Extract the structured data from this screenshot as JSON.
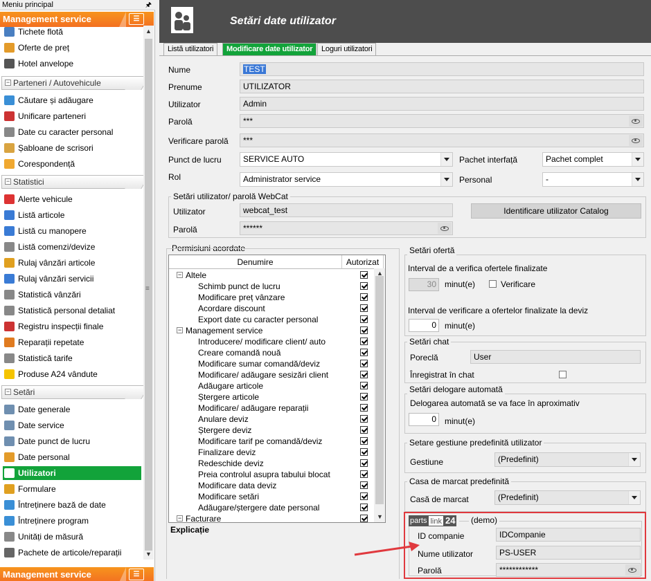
{
  "sidebar": {
    "menu_title": "Meniu principal",
    "top_bar": "Management service",
    "bottom_bar": "Management service",
    "items_a": [
      {
        "label": "Tichete flotă",
        "icon": "ticket-icon"
      },
      {
        "label": "Oferte de preț",
        "icon": "offer-icon"
      },
      {
        "label": "Hotel anvelope",
        "icon": "tire-icon"
      }
    ],
    "group_partners": "Parteneri / Autovehicule",
    "items_b": [
      {
        "label": "Căutare și adăugare",
        "icon": "search-add-icon"
      },
      {
        "label": "Unificare parteneri",
        "icon": "merge-partners-icon"
      },
      {
        "label": "Date cu caracter personal",
        "icon": "personal-data-icon"
      },
      {
        "label": "Șabloane de scrisori",
        "icon": "letter-template-icon"
      },
      {
        "label": "Corespondență",
        "icon": "mail-icon"
      }
    ],
    "group_stats": "Statistici",
    "items_c": [
      {
        "label": "Alerte vehicule",
        "icon": "alert-icon"
      },
      {
        "label": "Listă articole",
        "icon": "list-icon"
      },
      {
        "label": "Listă cu manopere",
        "icon": "wrench-icon"
      },
      {
        "label": "Listă comenzi/devize",
        "icon": "orders-icon"
      },
      {
        "label": "Rulaj vânzări articole",
        "icon": "sales-icon"
      },
      {
        "label": "Rulaj vânzări servicii",
        "icon": "services-icon"
      },
      {
        "label": "Statistică vânzări",
        "icon": "chart-icon"
      },
      {
        "label": "Statistică personal detaliat",
        "icon": "staff-chart-icon"
      },
      {
        "label": "Registru inspecții finale",
        "icon": "inspection-icon"
      },
      {
        "label": "Reparații repetate",
        "icon": "repeat-icon"
      },
      {
        "label": "Statistică tarife",
        "icon": "tariff-icon"
      },
      {
        "label": "Produse A24 vândute",
        "icon": "a24-icon"
      }
    ],
    "group_settings": "Setări",
    "items_d": [
      {
        "label": "Date generale",
        "icon": "doc-icon"
      },
      {
        "label": "Date service",
        "icon": "doc-icon"
      },
      {
        "label": "Date punct de lucru",
        "icon": "workplace-icon"
      },
      {
        "label": "Date personal",
        "icon": "person-icon"
      },
      {
        "label": "Utilizatori",
        "icon": "users-icon",
        "active": true
      },
      {
        "label": "Formulare",
        "icon": "form-icon"
      },
      {
        "label": "Întreținere bază de date",
        "icon": "database-icon"
      },
      {
        "label": "Întreținere program",
        "icon": "program-icon"
      },
      {
        "label": "Unități de măsură",
        "icon": "measure-icon"
      },
      {
        "label": "Pachete de articole/reparații",
        "icon": "package-icon"
      }
    ]
  },
  "header": {
    "title": "Setări date utilizator"
  },
  "tabs": [
    "Listă utilizatori",
    "Modificare date utilizator",
    "Loguri utilizatori"
  ],
  "form": {
    "nume_label": "Nume",
    "nume_value": "TEST",
    "prenume_label": "Prenume",
    "prenume_value": "UTILIZATOR",
    "utilizator_label": "Utilizator",
    "utilizator_value": "Admin",
    "parola_label": "Parolă",
    "parola_value": "***",
    "verificare_label": "Verificare parolă",
    "verificare_value": "***",
    "punct_label": "Punct de lucru",
    "punct_value": "SERVICE AUTO",
    "pachet_label": "Pachet interfață",
    "pachet_value": "Pachet complet",
    "rol_label": "Rol",
    "rol_value": "Administrator service",
    "personal_label": "Personal",
    "personal_value": "-"
  },
  "webcat": {
    "title": "Setări utilizator/ parolă WebCat",
    "user_label": "Utilizator",
    "user_value": "webcat_test",
    "pass_label": "Parolă",
    "pass_value": "******",
    "button": "Identificare utilizator Catalog"
  },
  "permissions": {
    "title": "Permisiuni acordate",
    "col_name": "Denumire",
    "col_auth": "Autorizat",
    "groups": [
      {
        "name": "Altele",
        "items": [
          "Schimb punct de lucru",
          "Modificare preț vânzare",
          "Acordare discount",
          "Export date cu caracter personal"
        ]
      },
      {
        "name": "Management service",
        "items": [
          "Introducere/ modificare client/ auto",
          "Creare comandă nouă",
          "Modificare sumar comandă/deviz",
          "Modificare/ adăugare sesizări client",
          "Adăugare articole",
          "Ștergere articole",
          "Modificare/ adăugare reparații",
          "Anulare deviz",
          "Ștergere deviz",
          "Modificare tarif pe comandă/deviz",
          "Finalizare deviz",
          "Redeschide deviz",
          "Preia controlul asupra tabului blocat",
          "Modificare data deviz",
          "Modificare setări",
          "Adăugare/ștergere date personal"
        ]
      },
      {
        "name": "Facturare",
        "items": []
      }
    ],
    "explanation": "Explicație"
  },
  "offer": {
    "title": "Setări ofertă",
    "interval_label": "Interval de a verifica ofertele finalizate",
    "interval_value": "30",
    "unit1": "minut(e)",
    "check_label": "Verificare",
    "deviz_label": "Interval de verificare a ofertelor finalizate la deviz",
    "deviz_value": "0",
    "unit2": "minut(e)"
  },
  "chat": {
    "title": "Setări chat",
    "nick_label": "Poreclă",
    "nick_value": "User",
    "record_label": "Înregistrat în chat"
  },
  "delegation": {
    "title": "Setări delogare automată",
    "desc": "Delogarea automată se va face în aproximativ",
    "value": "0",
    "unit": "minut(e)"
  },
  "gestiune": {
    "title": "Setare gestiune predefinită utilizator",
    "label": "Gestiune",
    "value": "(Predefinit)"
  },
  "register": {
    "title": "Casa de marcat predefinită",
    "label": "Casă de marcat",
    "value": "(Predefinit)"
  },
  "partslink": {
    "logo_a": "parts",
    "logo_b": "link",
    "logo_c": "24",
    "demo": "(demo)",
    "company_label": "ID companie",
    "company_value": "IDCompanie",
    "user_label": "Nume utilizator",
    "user_value": "PS-USER",
    "pass_label": "Parolă",
    "pass_value": "************"
  },
  "colors": {
    "accent_orange": "#f37021",
    "active_green": "#12a33a",
    "header_gray": "#4d4d4d",
    "highlight_red": "#e0393e"
  }
}
